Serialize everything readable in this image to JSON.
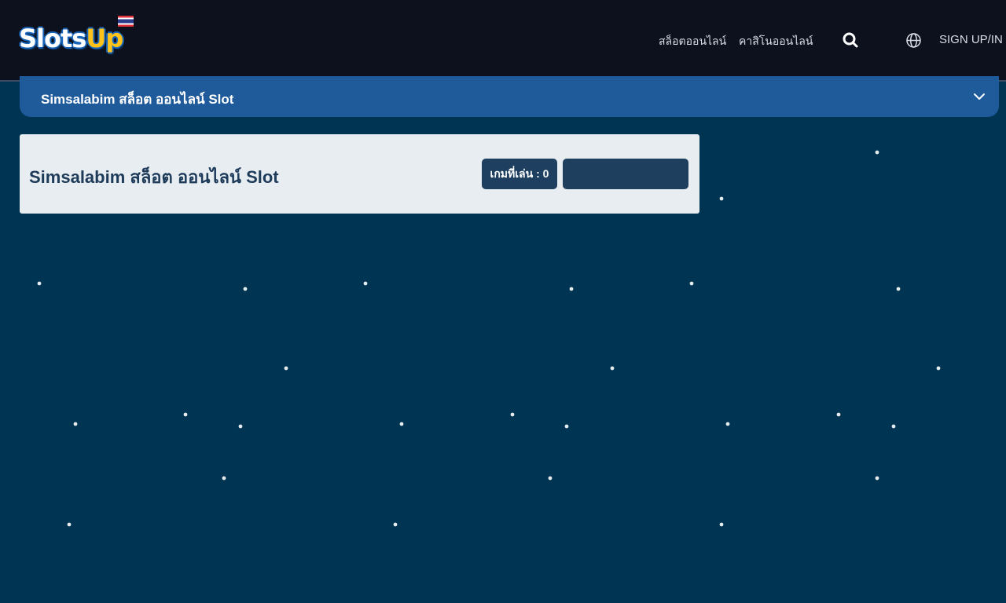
{
  "header": {
    "logo": {
      "text_main": "Sl",
      "text_o": "o",
      "text_ts": "ts",
      "text_up": "Up"
    },
    "nav": [
      {
        "label": "สล็อตออนไลน์"
      },
      {
        "label": "คาสิโนออนไลน์"
      }
    ],
    "icons": {
      "search": "search-icon",
      "language": "globe-icon",
      "flag": "thailand-flag-icon"
    },
    "auth_label": "SIGN UP/IN"
  },
  "breadcrumb": {
    "title": "Simsalabim สล็อต ออนไลน์ Slot",
    "toggle_icon": "chevron-down-icon"
  },
  "game": {
    "title": "Simsalabim สล็อต ออนไลน์ Slot",
    "played_label": "เกมที่เล่น : 0",
    "action_label": ""
  },
  "colors": {
    "background": "#003453",
    "header": "#0c111d",
    "accent_blue": "#1f5b9a",
    "card": "#e8edf2",
    "badge": "#1e3f5f",
    "logo_yellow": "#ffc21a"
  }
}
